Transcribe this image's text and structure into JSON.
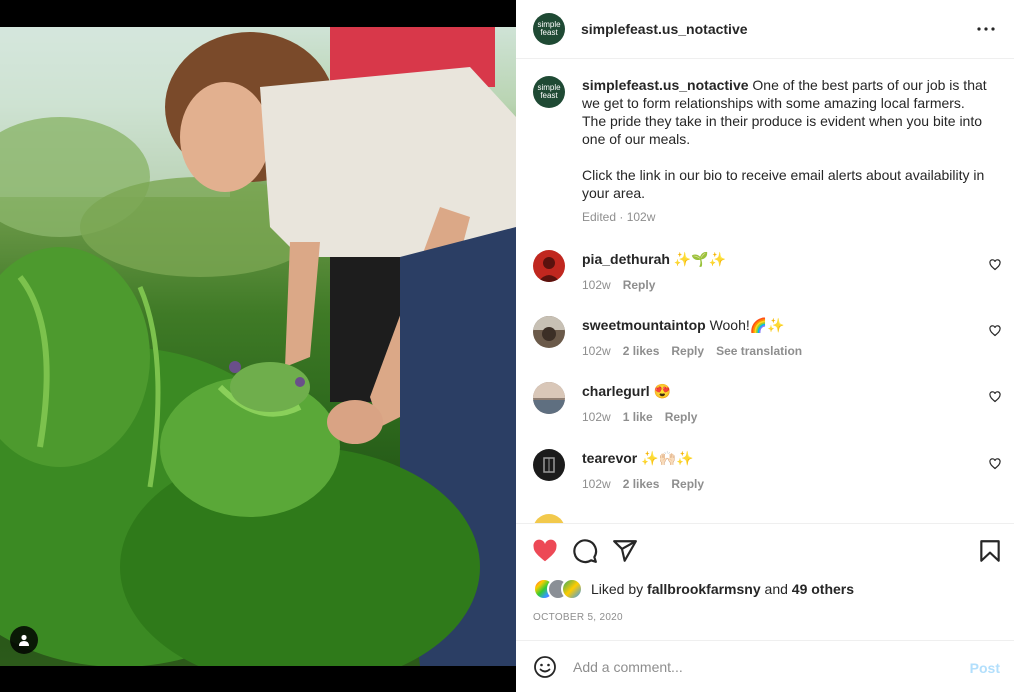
{
  "post": {
    "username": "simplefeast.us_notactive",
    "brand_avatar_line1": "simple",
    "brand_avatar_line2": "feast",
    "caption": "One of the best parts of our job is that we get to form relationships with some amazing local farmers. The pride they take in their produce is evident when you bite into one of our meals.\n\nClick the link in our bio to receive email alerts about availability in your area.",
    "caption_meta": "Edited · 102w"
  },
  "comments": [
    {
      "username": "pia_dethurah",
      "text": "✨🌱✨",
      "age": "102w",
      "likes": "",
      "reply": "Reply",
      "translate": "",
      "avatar_color": "#c0271f"
    },
    {
      "username": "sweetmountaintop",
      "text": "Wooh!🌈✨",
      "age": "102w",
      "likes": "2 likes",
      "reply": "Reply",
      "translate": "See translation",
      "avatar_color": "#6b5a4a"
    },
    {
      "username": "charlegurl",
      "text": "😍",
      "age": "102w",
      "likes": "1 like",
      "reply": "Reply",
      "translate": "",
      "avatar_color": "#8f7e72"
    },
    {
      "username": "tearevor",
      "text": "✨🙌🏻✨",
      "age": "102w",
      "likes": "2 likes",
      "reply": "Reply",
      "translate": "",
      "avatar_color": "#1b1b1b"
    }
  ],
  "likes": {
    "prefix": "Liked by",
    "user": "fallbrookfarmsny",
    "joiner": "and",
    "others": "49 others"
  },
  "date": "OCTOBER 5, 2020",
  "add_comment": {
    "placeholder": "Add a comment...",
    "post_label": "Post"
  },
  "icons": {
    "like": "heart-filled-icon",
    "comment": "comment-icon",
    "share": "paper-plane-icon",
    "save": "bookmark-icon",
    "more": "ellipsis-icon",
    "emoji": "smiley-icon",
    "user_tag": "user-icon"
  },
  "colors": {
    "like_red": "#ed4956",
    "brand_green": "#1f4a34",
    "post_blue_disabled": "#b2dffc",
    "secondary_text": "#8e8e8e"
  }
}
